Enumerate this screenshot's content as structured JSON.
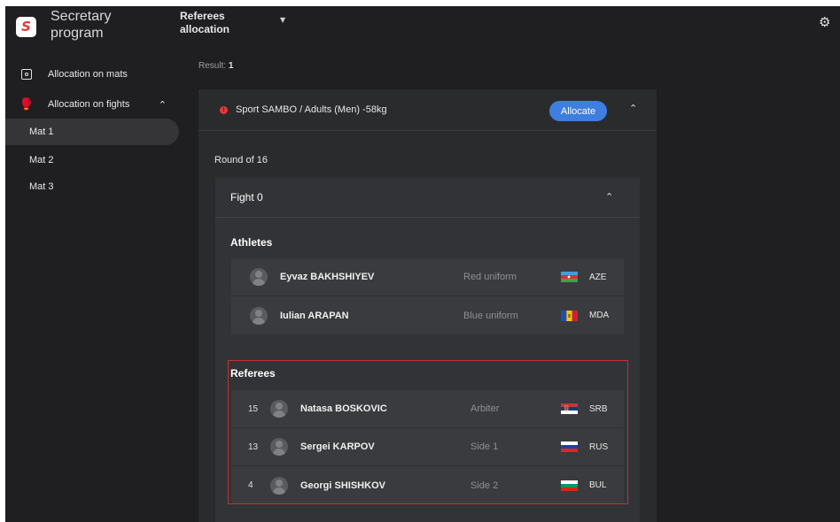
{
  "app": {
    "brand": "Secretary program",
    "logo_letter": "S"
  },
  "header": {
    "title": "Referees allocation"
  },
  "sidebar": {
    "items": [
      {
        "label": "Allocation on mats",
        "icon": "mats-icon"
      },
      {
        "label": "Allocation on fights",
        "icon": "fights-icon",
        "expanded": true
      }
    ],
    "mats": [
      "Mat 1",
      "Mat 2",
      "Mat 3"
    ],
    "active_mat": "Mat 1"
  },
  "result": {
    "label": "Result:",
    "count": "1"
  },
  "category": {
    "title": "Sport SAMBO / Adults (Men) -58kg",
    "allocate_label": "Allocate",
    "status_icon": "error-icon"
  },
  "round": "Round of 16",
  "fight": {
    "title": "Fight 0",
    "athletes_label": "Athletes",
    "athletes": [
      {
        "name": "Eyvaz BAKHSHIYEV",
        "role": "Red uniform",
        "country": "AZE"
      },
      {
        "name": "Iulian ARAPAN",
        "role": "Blue uniform",
        "country": "MDA"
      }
    ],
    "referees_label": "Referees",
    "referees": [
      {
        "number": "15",
        "name": "Natasa BOSKOVIC",
        "role": "Arbiter",
        "country": "SRB"
      },
      {
        "number": "13",
        "name": "Sergei KARPOV",
        "role": "Side 1",
        "country": "RUS"
      },
      {
        "number": "4",
        "name": "Georgi SHISHKOV",
        "role": "Side 2",
        "country": "BUL"
      }
    ]
  },
  "colors": {
    "accent": "#3d7ee0",
    "error": "#e53935",
    "highlight": "#c9302c",
    "background": "#1f1f21"
  }
}
